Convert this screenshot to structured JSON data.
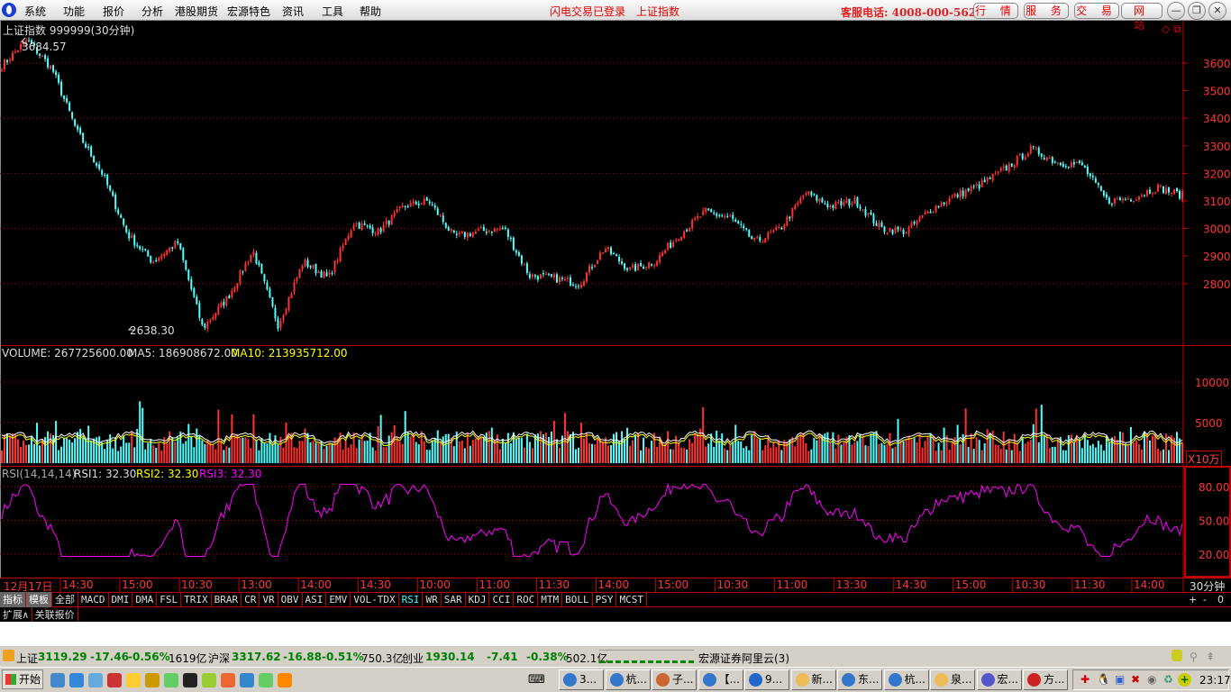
{
  "menubar": {
    "items": [
      "系统",
      "功能",
      "报价",
      "分析",
      "港股期货",
      "宏源特色",
      "资讯",
      "工具",
      "帮助"
    ],
    "flash_login": "闪电交易已登录",
    "index_name": "上证指数",
    "hotline": "客服电话: 4008-000-562",
    "buttons": [
      "行 情",
      "服 务",
      "交 易",
      "网 站"
    ]
  },
  "chart_header": {
    "title": "上证指数 999999(30分钟)",
    "high_label": "3684.57",
    "low_label": "2638.30"
  },
  "volume_header": {
    "volume": "VOLUME: 267725600.00",
    "ma5": "MA5: 186908672.00",
    "ma10": "MA10: 213935712.00",
    "unit": "X10万"
  },
  "rsi_header": {
    "name": "RSI(14,14,14)",
    "rsi1": "RSI1: 32.30",
    "rsi2": "RSI2: 32.30",
    "rsi3": "RSI3: 32.30"
  },
  "period_label": "30分钟",
  "zoom_buttons": [
    "+",
    "-",
    "0"
  ],
  "time_labels": [
    "12月17日",
    "14:30",
    "15:00",
    "10:30",
    "13:00",
    "14:00",
    "14:30",
    "10:00",
    "11:00",
    "11:30",
    "14:00",
    "15:00",
    "10:30",
    "11:00",
    "13:30",
    "14:30",
    "15:00",
    "10:30",
    "11:30",
    "14:00"
  ],
  "indicator_tabs": [
    "指标",
    "模板",
    "全部",
    "MACD",
    "DMI",
    "DMA",
    "FSL",
    "TRIX",
    "BRAR",
    "CR",
    "VR",
    "OBV",
    "ASI",
    "EMV",
    "VOL-TDX",
    "RSI",
    "WR",
    "SAR",
    "KDJ",
    "CCI",
    "ROC",
    "MTM",
    "BOLL",
    "PSY",
    "MCST"
  ],
  "active_tab": "RSI",
  "sub_tabs": [
    "扩展∧",
    "关联报价"
  ],
  "status": {
    "sh_name": "上证",
    "sh_val": "3119.29",
    "sh_chg": "-17.46",
    "sh_pct": "-0.56%",
    "sh_amt": "1619亿",
    "hs_name": "沪深",
    "hs_val": "3317.62",
    "hs_chg": "-16.88",
    "hs_pct": "-0.51%",
    "hs_amt": "750.3亿",
    "cy_name": "创业",
    "cy_val": "1930.14",
    "cy_chg": "-7.41",
    "cy_pct": "-0.38%",
    "cy_amt": "502.1亿",
    "server": "宏源证券阿里云(3)"
  },
  "taskbar": {
    "start": "开始",
    "tasks": [
      "3...",
      "杭...",
      "子...",
      "【...",
      "9...",
      "新...",
      "东...",
      "杭...",
      "泉...",
      "宏...",
      "方..."
    ],
    "clock": "23:17"
  },
  "colors": {
    "up": "#ff3232",
    "down": "#54ffff",
    "ma10": "#ffff00",
    "rsi": "#ff00ff",
    "grid": "#c00000"
  },
  "chart_data": {
    "type": "candlestick",
    "y_ticks": [
      2800,
      2900,
      3000,
      3100,
      3200,
      3300,
      3400,
      3500,
      3600
    ],
    "ylim": [
      2700,
      3700
    ],
    "volume_ticks": [
      5000,
      10000
    ],
    "rsi_ticks": [
      20,
      50,
      80
    ],
    "close_anchors": [
      3590,
      3684,
      3580,
      3350,
      3200,
      2980,
      2880,
      2950,
      2638,
      2750,
      2920,
      2650,
      2880,
      2820,
      3020,
      2990,
      3080,
      3100,
      2970,
      2990,
      3000,
      2830,
      2820,
      2800,
      2930,
      2850,
      2880,
      2980,
      3060,
      3040,
      2950,
      3000,
      3130,
      3080,
      3100,
      3000,
      2990,
      3070,
      3120,
      3160,
      3220,
      3290,
      3240,
      3230,
      3100,
      3110,
      3150,
      3120
    ]
  }
}
